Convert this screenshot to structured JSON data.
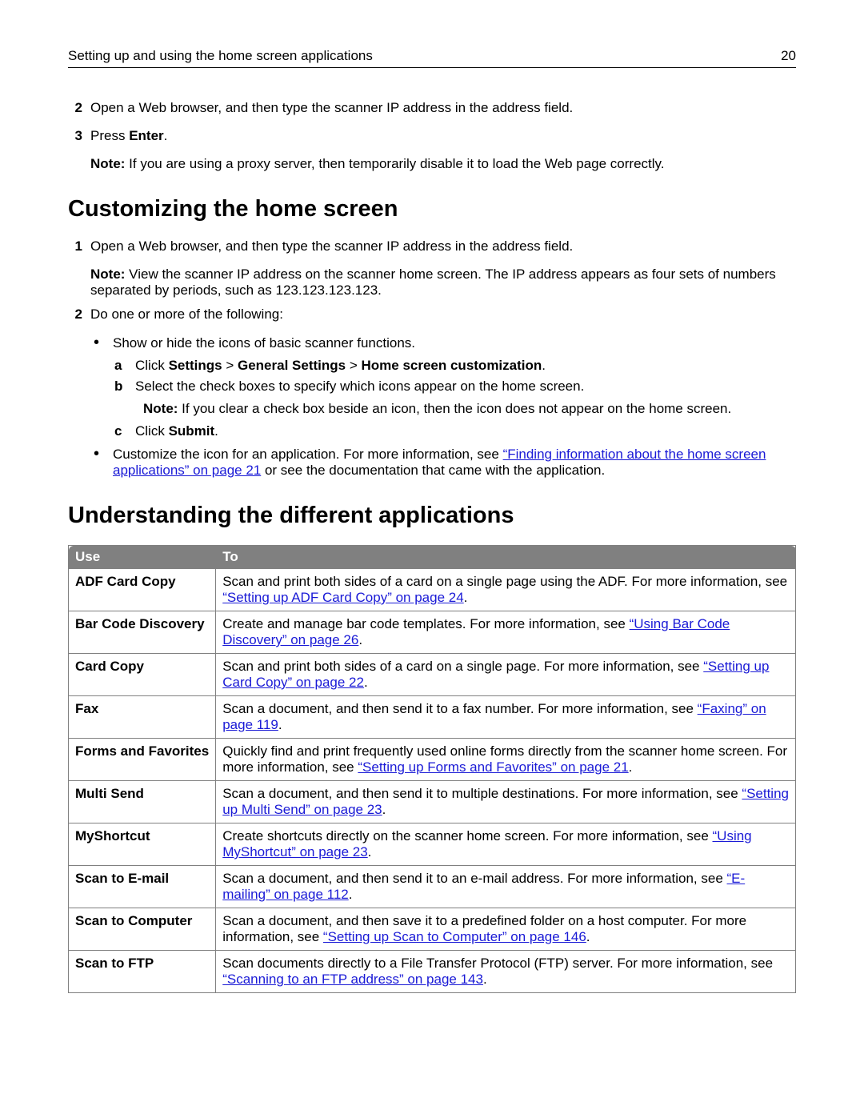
{
  "header": {
    "title": "Setting up and using the home screen applications",
    "page": "20"
  },
  "intro": {
    "step2_num": "2",
    "step2": "Open a Web browser, and then type the scanner IP address in the address field.",
    "step3_num": "3",
    "step3_pre": "Press ",
    "step3_bold": "Enter",
    "step3_post": ".",
    "note_lbl": "Note:",
    "note": " If you are using a proxy server, then temporarily disable it to load the Web page correctly."
  },
  "custom": {
    "heading": "Customizing the home screen",
    "s1_num": "1",
    "s1": "Open a Web browser, and then type the scanner IP address in the address field.",
    "s1_note_lbl": "Note:",
    "s1_note": " View the scanner IP address on the scanner home screen. The IP address appears as four sets of numbers separated by periods, such as 123.123.123.123.",
    "s2_num": "2",
    "s2": "Do one or more of the following:",
    "b1": "Show or hide the icons of basic scanner functions.",
    "a_lbl": "a",
    "a_pre": "Click ",
    "a_b1": "Settings",
    "a_gt1": " > ",
    "a_b2": "General Settings",
    "a_gt2": " > ",
    "a_b3": "Home screen customization",
    "a_post": ".",
    "b_lbl": "b",
    "b_txt": "Select the check boxes to specify which icons appear on the home screen.",
    "b_note_lbl": "Note:",
    "b_note": " If you clear a check box beside an icon, then the icon does not appear on the home screen.",
    "c_lbl": "c",
    "c_pre": "Click ",
    "c_bold": "Submit",
    "c_post": ".",
    "b2_pre": "Customize the icon for an application. For more information, see ",
    "b2_link": "“Finding information about the home screen applications” on page 21",
    "b2_post": " or see the documentation that came with the application."
  },
  "apps_heading": "Understanding the different applications",
  "table": {
    "h1": "Use",
    "h2": "To",
    "rows": [
      {
        "use": "ADF Card Copy",
        "pre": "Scan and print both sides of a card on a single page using the ADF. For more information, see ",
        "link": "“Setting up ADF Card Copy” on page 24",
        "post": "."
      },
      {
        "use": "Bar Code Discovery",
        "pre": "Create and manage bar code templates. For more information, see ",
        "link": "“Using Bar Code Discovery” on page 26",
        "post": "."
      },
      {
        "use": "Card Copy",
        "pre": "Scan and print both sides of a card on a single page. For more information, see ",
        "link": "“Setting up Card Copy” on page 22",
        "post": "."
      },
      {
        "use": "Fax",
        "pre": "Scan a document, and then send it to a fax number. For more information, see ",
        "link": "“Faxing” on page 119",
        "post": "."
      },
      {
        "use": "Forms and Favorites",
        "pre": "Quickly find and print frequently used online forms directly from the scanner home screen. For more information, see ",
        "link": "“Setting up Forms and Favorites” on page 21",
        "post": "."
      },
      {
        "use": "Multi Send",
        "pre": "Scan a document, and then send it to multiple destinations. For more information, see ",
        "link": "“Setting up Multi Send” on page 23",
        "post": "."
      },
      {
        "use": "MyShortcut",
        "pre": "Create shortcuts directly on the scanner home screen. For more information, see ",
        "link": "“Using MyShortcut” on page 23",
        "post": "."
      },
      {
        "use": "Scan to E-mail",
        "pre": "Scan a document, and then send it to an e-mail address. For more information, see ",
        "link": "“E-mailing” on page 112",
        "post": "."
      },
      {
        "use": "Scan to Computer",
        "pre": "Scan a document, and then save it to a predefined folder on a host computer. For more information, see ",
        "link": "“Setting up Scan to Computer” on page 146",
        "post": "."
      },
      {
        "use": "Scan to FTP",
        "pre": "Scan documents directly to a File Transfer Protocol (FTP) server. For more information, see ",
        "link": "“Scanning to an FTP address” on page 143",
        "post": "."
      }
    ]
  }
}
